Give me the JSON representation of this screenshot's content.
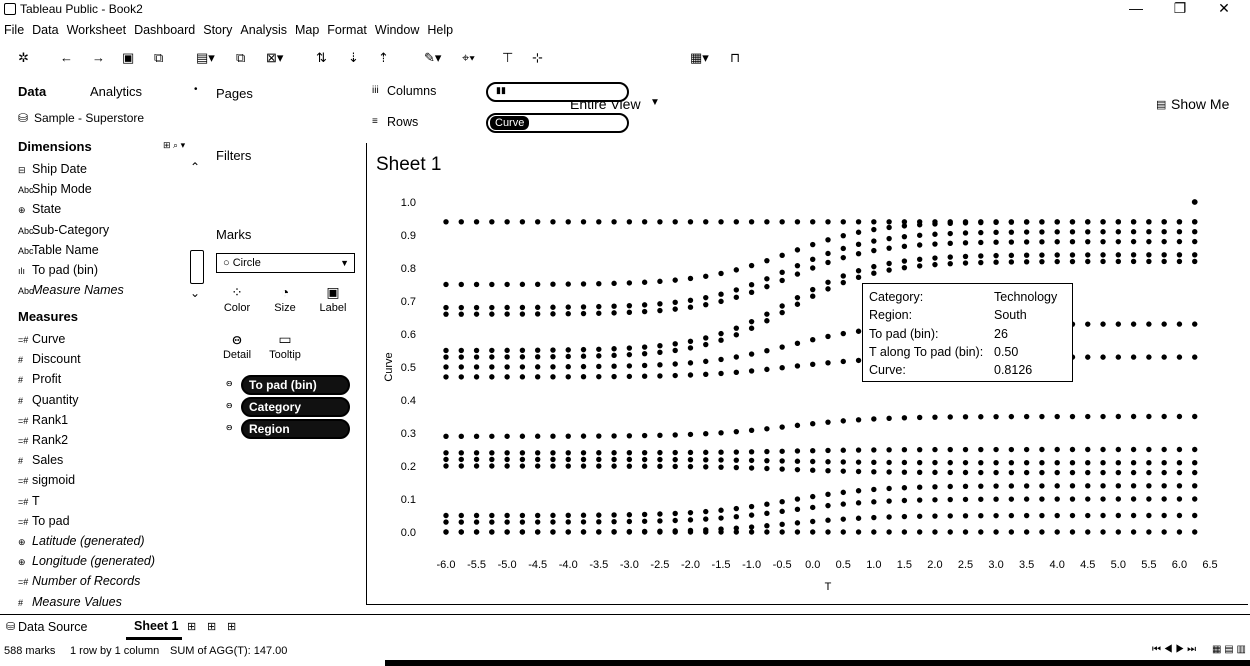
{
  "window": {
    "title": "Tableau Public - Book2",
    "minimize": "—",
    "restore": "❐",
    "close": "✕"
  },
  "menu": [
    "File",
    "Data",
    "Worksheet",
    "Dashboard",
    "Story",
    "Analysis",
    "Map",
    "Format",
    "Window",
    "Help"
  ],
  "toolbar": {
    "fit_value": "Entire View",
    "show_me_label": "Show Me"
  },
  "data_pane": {
    "tab_data": "Data",
    "tab_analytics": "Analytics",
    "datasource": "Sample - Superstore",
    "dimensions_header": "Dimensions",
    "dimensions": [
      {
        "icon": "⊟",
        "name": "Ship Date",
        "italic": false
      },
      {
        "icon": "Abc",
        "name": "Ship Mode",
        "italic": false
      },
      {
        "icon": "⊕",
        "name": "State",
        "italic": false
      },
      {
        "icon": "Abc",
        "name": "Sub-Category",
        "italic": false
      },
      {
        "icon": "Abc",
        "name": "Table Name",
        "italic": false
      },
      {
        "icon": "ılı",
        "name": "To pad (bin)",
        "italic": false
      },
      {
        "icon": "Abc",
        "name": "Measure Names",
        "italic": true
      }
    ],
    "measures_header": "Measures",
    "measures": [
      {
        "icon": "=#",
        "name": "Curve",
        "italic": false
      },
      {
        "icon": "#",
        "name": "Discount",
        "italic": false
      },
      {
        "icon": "#",
        "name": "Profit",
        "italic": false
      },
      {
        "icon": "#",
        "name": "Quantity",
        "italic": false
      },
      {
        "icon": "=#",
        "name": "Rank1",
        "italic": false
      },
      {
        "icon": "=#",
        "name": "Rank2",
        "italic": false
      },
      {
        "icon": "#",
        "name": "Sales",
        "italic": false
      },
      {
        "icon": "=#",
        "name": "sigmoid",
        "italic": false
      },
      {
        "icon": "=#",
        "name": "T",
        "italic": false
      },
      {
        "icon": "=#",
        "name": "To pad",
        "italic": false
      },
      {
        "icon": "⊕",
        "name": "Latitude (generated)",
        "italic": true
      },
      {
        "icon": "⊕",
        "name": "Longitude (generated)",
        "italic": true
      },
      {
        "icon": "=#",
        "name": "Number of Records",
        "italic": true
      },
      {
        "icon": "#",
        "name": "Measure Values",
        "italic": true
      }
    ]
  },
  "shelves": {
    "pages": "Pages",
    "filters": "Filters",
    "marks": "Marks",
    "columns_label": "Columns",
    "rows_label": "Rows",
    "columns_pill": "",
    "rows_pill": "Curve"
  },
  "marks_card": {
    "mark_type": "Circle",
    "buttons": [
      {
        "icon": "⁘",
        "label": "Color"
      },
      {
        "icon": "◔",
        "label": "Size"
      },
      {
        "icon": "▣",
        "label": "Label"
      },
      {
        "icon": "ꙫ",
        "label": "Detail"
      },
      {
        "icon": "▭",
        "label": "Tooltip"
      }
    ],
    "pills": [
      "To pad (bin)",
      "Category",
      "Region"
    ]
  },
  "sheet_title": "Sheet 1",
  "tooltip": [
    {
      "key": "Category:",
      "value": "Technology"
    },
    {
      "key": "Region:",
      "value": "South"
    },
    {
      "key": "To pad (bin):",
      "value": "26"
    },
    {
      "key": "T along To pad (bin):",
      "value": "0.50"
    },
    {
      "key": "Curve:",
      "value": "0.8126"
    }
  ],
  "tabs": {
    "data_source": "Data Source",
    "sheet": "Sheet 1"
  },
  "status": {
    "marks": "588 marks",
    "layout": "1 row by 1 column",
    "sum": "SUM of AGG(T): 147.00"
  },
  "chart_data": {
    "type": "scatter",
    "xlabel": "T",
    "ylabel": "Curve",
    "xlim": [
      -6.0,
      6.5
    ],
    "ylim": [
      0.0,
      1.0
    ],
    "xticks": [
      "-6.0",
      "-5.5",
      "-5.0",
      "-4.5",
      "-4.0",
      "-3.5",
      "-3.0",
      "-2.5",
      "-2.0",
      "-1.5",
      "-1.0",
      "-0.5",
      "0.0",
      "0.5",
      "1.0",
      "1.5",
      "2.0",
      "2.5",
      "3.0",
      "3.5",
      "4.0",
      "4.5",
      "5.0",
      "5.5",
      "6.0",
      "6.5"
    ],
    "yticks": [
      "0.0",
      "0.1",
      "0.2",
      "0.3",
      "0.4",
      "0.5",
      "0.6",
      "0.7",
      "0.8",
      "0.9",
      "1.0"
    ],
    "grid": false,
    "x_start": -6.0,
    "x_step": 0.25,
    "n_points": 50,
    "series": [
      {
        "start": 0.94,
        "end": 0.94
      },
      {
        "start": 0.75,
        "end": 0.94
      },
      {
        "start": 0.68,
        "end": 0.91
      },
      {
        "start": 0.66,
        "end": 0.88
      },
      {
        "start": 0.55,
        "end": 0.84
      },
      {
        "start": 0.53,
        "end": 0.82
      },
      {
        "start": 0.5,
        "end": 0.63
      },
      {
        "start": 0.47,
        "end": 0.53
      },
      {
        "start": 0.29,
        "end": 0.35
      },
      {
        "start": 0.24,
        "end": 0.25
      },
      {
        "start": 0.22,
        "end": 0.21
      },
      {
        "start": 0.2,
        "end": 0.18
      },
      {
        "start": 0.05,
        "end": 0.14
      },
      {
        "start": 0.03,
        "end": 0.1
      },
      {
        "start": 0.0,
        "end": 0.05
      },
      {
        "start": 0.0,
        "end": 0.0
      }
    ],
    "outlier": {
      "x": 6.25,
      "y": 1.0
    }
  }
}
